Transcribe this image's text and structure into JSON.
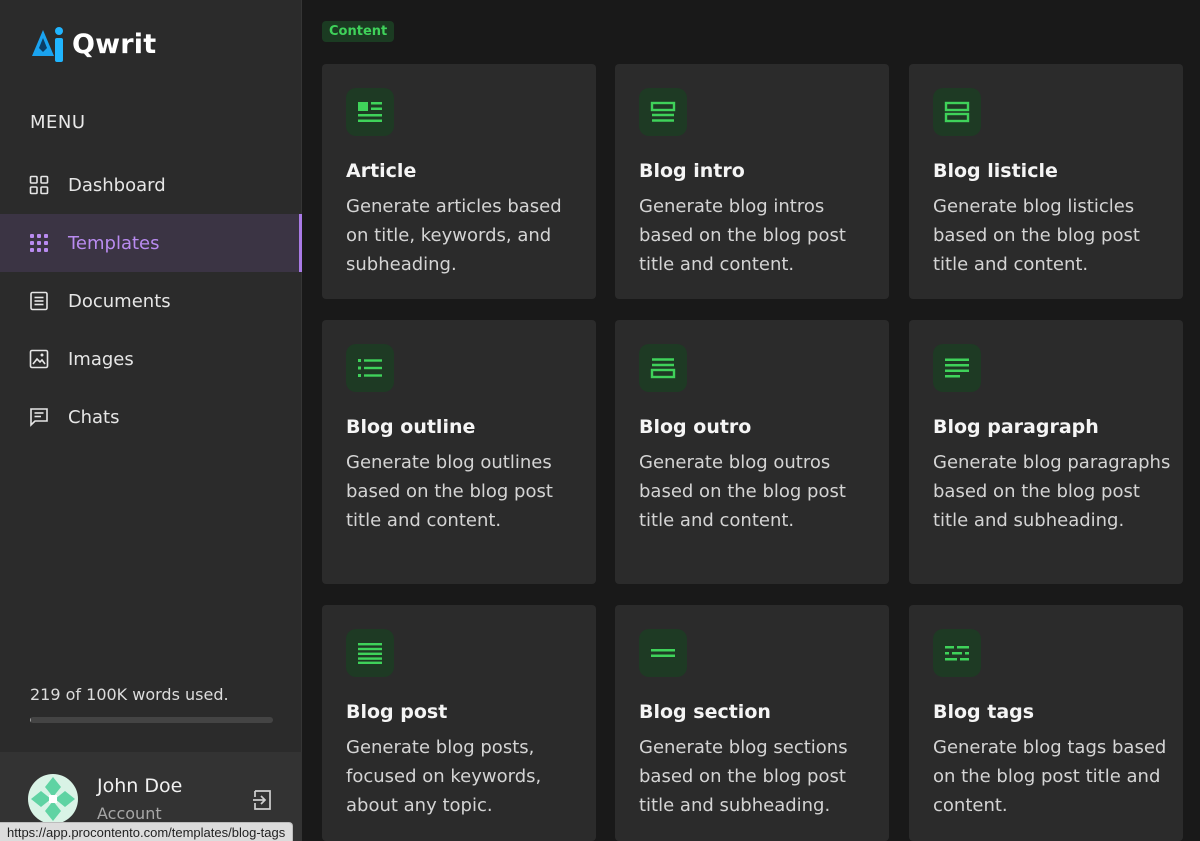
{
  "app": {
    "name": "Qwrit"
  },
  "sidebar": {
    "menu_title": "MENU",
    "items": [
      {
        "label": "Dashboard",
        "icon": "dashboard-icon"
      },
      {
        "label": "Templates",
        "icon": "templates-icon",
        "active": true
      },
      {
        "label": "Documents",
        "icon": "documents-icon"
      },
      {
        "label": "Images",
        "icon": "images-icon"
      },
      {
        "label": "Chats",
        "icon": "chats-icon"
      }
    ],
    "usage_text": "219 of 100K words used.",
    "usage_fraction": 0.00219
  },
  "user": {
    "name": "John Doe",
    "subtitle": "Account"
  },
  "status_bar": {
    "url": "https://app.procontento.com/templates/blog-tags"
  },
  "main": {
    "section_label": "Content",
    "cards": [
      {
        "title": "Article",
        "description": "Generate articles based on title, keywords, and subheading.",
        "icon": "article-icon"
      },
      {
        "title": "Blog intro",
        "description": "Generate blog intros based on the blog post title and content.",
        "icon": "blog-intro-icon"
      },
      {
        "title": "Blog listicle",
        "description": "Generate blog listicles based on the blog post title and content.",
        "icon": "blog-listicle-icon"
      },
      {
        "title": "Blog outline",
        "description": "Generate blog outlines based on the blog post title and content.",
        "icon": "blog-outline-icon"
      },
      {
        "title": "Blog outro",
        "description": "Generate blog outros based on the blog post title and content.",
        "icon": "blog-outro-icon"
      },
      {
        "title": "Blog paragraph",
        "description": "Generate blog paragraphs based on the blog post title and subheading.",
        "icon": "blog-paragraph-icon"
      },
      {
        "title": "Blog post",
        "description": "Generate blog posts, focused on keywords, about any topic.",
        "icon": "blog-post-icon"
      },
      {
        "title": "Blog section",
        "description": "Generate blog sections based on the blog post title and subheading.",
        "icon": "blog-section-icon"
      },
      {
        "title": "Blog tags",
        "description": "Generate blog tags based on the blog post title and content.",
        "icon": "blog-tags-icon"
      }
    ]
  },
  "colors": {
    "accent_green": "#3fd25a",
    "active_purple": "#b98bf0",
    "background": "#191919",
    "card": "#2b2b2b"
  }
}
